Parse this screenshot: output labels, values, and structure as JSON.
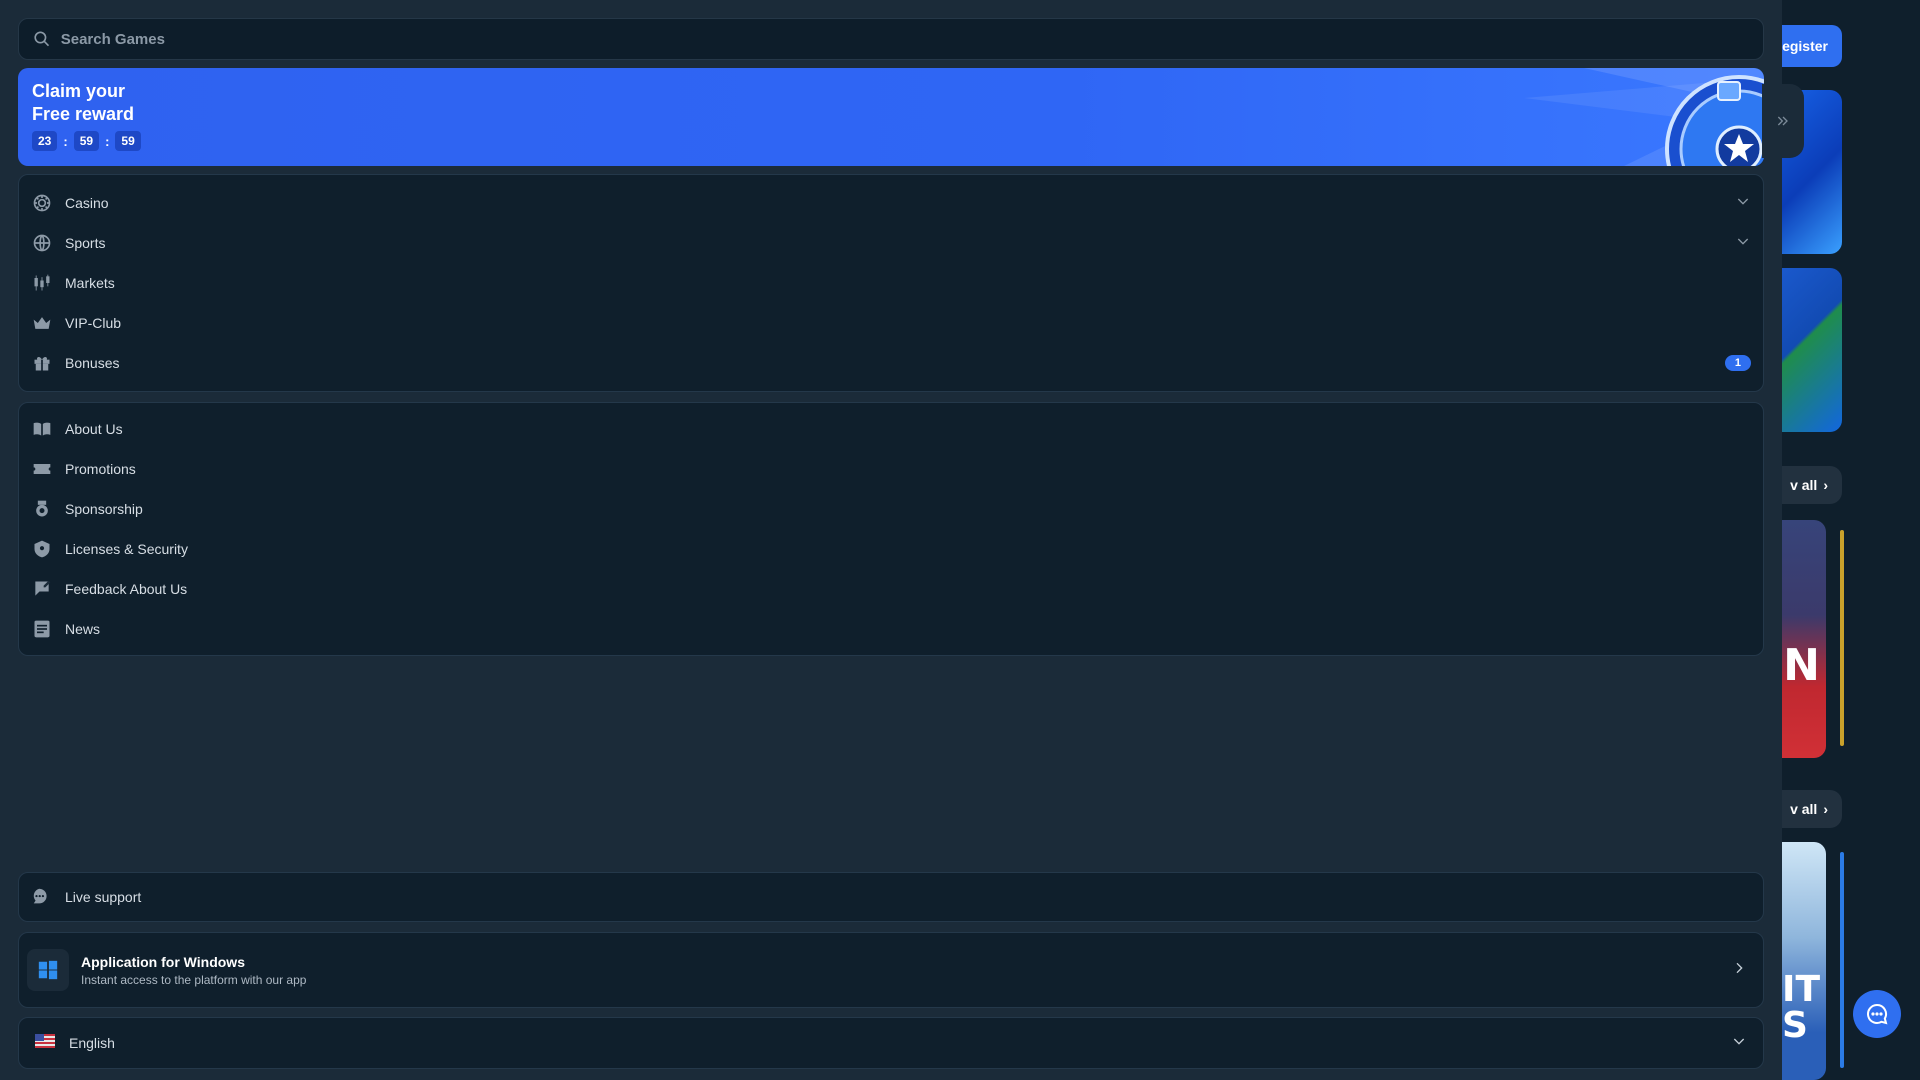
{
  "search": {
    "placeholder": "Search Games"
  },
  "banner": {
    "title_line1": "Claim your",
    "title_line2": "Free reward",
    "timer": {
      "hours": "23",
      "minutes": "59",
      "seconds": "59",
      "separator": ":"
    }
  },
  "nav_main": [
    {
      "label": "Casino",
      "icon": "casino-icon",
      "expandable": true
    },
    {
      "label": "Sports",
      "icon": "sports-globe-icon",
      "expandable": true
    },
    {
      "label": "Markets",
      "icon": "markets-candles-icon",
      "expandable": false
    },
    {
      "label": "VIP-Club",
      "icon": "crown-icon",
      "expandable": false
    },
    {
      "label": "Bonuses",
      "icon": "gift-icon",
      "expandable": false,
      "badge": "1"
    }
  ],
  "nav_info": [
    {
      "label": "About Us",
      "icon": "book-icon"
    },
    {
      "label": "Promotions",
      "icon": "ticket-icon"
    },
    {
      "label": "Sponsorship",
      "icon": "medal-icon"
    },
    {
      "label": "Licenses & Security",
      "icon": "shield-icon"
    },
    {
      "label": "Feedback About Us",
      "icon": "feedback-icon"
    },
    {
      "label": "News",
      "icon": "newspaper-icon"
    }
  ],
  "support": {
    "label": "Live support"
  },
  "app": {
    "title": "Application for Windows",
    "subtitle": "Instant access to the platform with our app"
  },
  "language": {
    "label": "English"
  },
  "background": {
    "register_label": "egister",
    "view_all_label": "v all",
    "tile1_text": "N",
    "tile3_text": "IT\nS"
  },
  "colors": {
    "accent": "#2f6ff0",
    "panel": "#1b2b39",
    "surface": "#0f1f2c"
  }
}
